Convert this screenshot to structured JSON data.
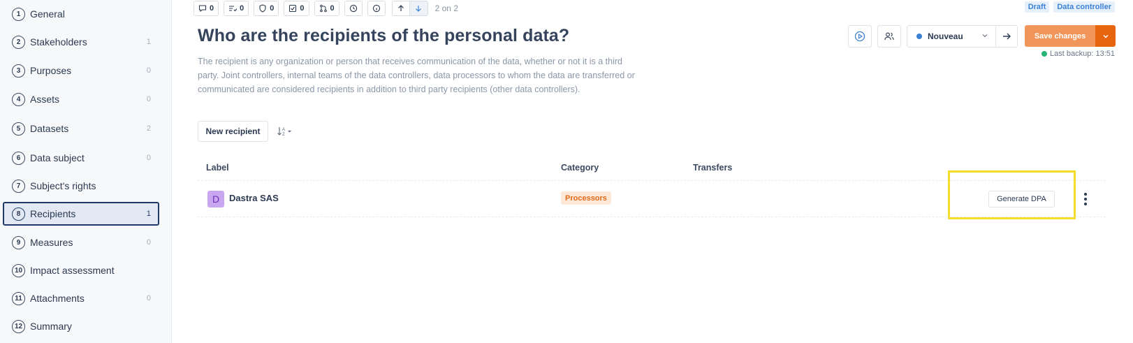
{
  "sidebar": {
    "items": [
      {
        "num": "1",
        "label": "General",
        "count": ""
      },
      {
        "num": "2",
        "label": "Stakeholders",
        "count": "1"
      },
      {
        "num": "3",
        "label": "Purposes",
        "count": "0"
      },
      {
        "num": "4",
        "label": "Assets",
        "count": "0"
      },
      {
        "num": "5",
        "label": "Datasets",
        "count": "2"
      },
      {
        "num": "6",
        "label": "Data subject",
        "count": "0"
      },
      {
        "num": "7",
        "label": "Subject's rights",
        "count": ""
      },
      {
        "num": "8",
        "label": "Recipients",
        "count": "1"
      },
      {
        "num": "9",
        "label": "Measures",
        "count": "0"
      },
      {
        "num": "10",
        "label": "Impact assessment",
        "count": ""
      },
      {
        "num": "11",
        "label": "Attachments",
        "count": "0"
      },
      {
        "num": "12",
        "label": "Summary",
        "count": ""
      }
    ],
    "active": "8"
  },
  "toolbar": {
    "comments_count": "0",
    "tasks_count": "0",
    "risks_count": "0",
    "checks_count": "0",
    "versions_count": "0",
    "history_icon": "clock-icon",
    "info_icon": "info-icon",
    "pager": "2 on 2"
  },
  "badges": {
    "draft": "Draft",
    "role": "Data controller"
  },
  "header": {
    "title": "Who are the recipients of the personal data?",
    "description": "The recipient is any organization or person that receives communication of the data, whether or not it is a third party. Joint controllers, internal teams of the data controllers, data processors to whom the data are transferred or communicated are considered recipients in addition to third party recipients (other data controllers)."
  },
  "status": {
    "value": "Nouveau",
    "dot_color": "#3b82d6"
  },
  "save": {
    "label": "Save changes",
    "color": "#f0965a",
    "dropdown_color": "#e8650f"
  },
  "backup": {
    "text": "Last backup: 13:51"
  },
  "actions": {
    "new_recipient": "New recipient"
  },
  "table": {
    "columns": {
      "label": "Label",
      "category": "Category",
      "transfers": "Transfers"
    },
    "rows": [
      {
        "avatar": "D",
        "label": "Dastra SAS",
        "category": "Processors",
        "transfers": "",
        "action": "Generate DPA"
      }
    ]
  }
}
